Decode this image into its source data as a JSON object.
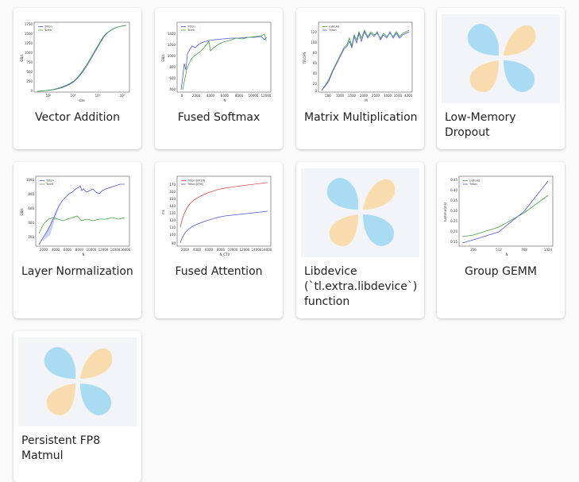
{
  "gallery": {
    "cards": [
      {
        "title": "Vector Addition"
      },
      {
        "title": "Fused Softmax"
      },
      {
        "title": "Matrix Multiplication"
      },
      {
        "title": "Low-Memory Dropout"
      },
      {
        "title": "Layer Normalization"
      },
      {
        "title": "Fused Attention"
      },
      {
        "title": "Libdevice (`tl.extra.libdevice`) function"
      },
      {
        "title": "Group GEMM"
      },
      {
        "title": "Persistent FP8 Matmul"
      }
    ]
  },
  "colors": {
    "blue_series": "#4a55d6",
    "green_series": "#3fa33f",
    "red_series": "#e04545",
    "logo_blue": "#a9dcf3",
    "logo_orange": "#f9dcae"
  },
  "thumbnails": {
    "vector_addition": {
      "legend": [
        "Triton",
        "Torch"
      ],
      "xlabel": "size",
      "ylabel": "GB/s",
      "yticks": [
        "1750",
        "1500",
        "1250",
        "1000",
        "750",
        "500",
        "250",
        "0"
      ],
      "xticks": [
        "10⁴",
        "10⁵",
        "10⁶",
        "10⁷"
      ]
    },
    "fused_softmax": {
      "legend": [
        "Triton",
        "Torch"
      ],
      "xlabel": "N",
      "ylabel": "GB/s",
      "yticks": [
        "1400",
        "1200",
        "1000",
        "800",
        "600",
        "400"
      ],
      "xticks": [
        "0",
        "2000",
        "4000",
        "6000",
        "8000",
        "10000",
        "12000"
      ]
    },
    "matrix_multiplication": {
      "legend": [
        "cuBLAS",
        "Triton"
      ],
      "xlabel": "M",
      "ylabel": "TFLOPS",
      "yticks": [
        "120",
        "100",
        "80",
        "60",
        "40",
        "20",
        "0"
      ],
      "xticks": [
        "500",
        "1000",
        "1500",
        "2000",
        "2500",
        "3000",
        "3500",
        "4000"
      ]
    },
    "layer_normalization": {
      "legend": [
        "Triton",
        "Torch"
      ],
      "xlabel": "N",
      "ylabel": "GB/s",
      "yticks": [
        "1000",
        "800",
        "600",
        "400",
        "200"
      ],
      "xticks": [
        "2000",
        "4000",
        "6000",
        "8000",
        "10000",
        "12000",
        "14000",
        "16000"
      ]
    },
    "fused_attention": {
      "legend": [
        "Triton [FP16]",
        "Triton [FP8]"
      ],
      "xlabel": "N_CTX",
      "ylabel": "ms",
      "yticks": [
        "170",
        "160",
        "150",
        "140",
        "130",
        "120",
        "110",
        "100",
        "90"
      ],
      "xticks": [
        "2000",
        "4000",
        "6000",
        "8000",
        "10000",
        "12000",
        "14000",
        "16000"
      ]
    },
    "group_gemm": {
      "legend": [
        "cuBLAS",
        "Triton"
      ],
      "xlabel": "N",
      "ylabel": "runtime(ms)",
      "yticks": [
        "0.45",
        "0.40",
        "0.35",
        "0.30",
        "0.25",
        "0.20",
        "0.15"
      ],
      "xticks": [
        "256",
        "512",
        "768",
        "1024"
      ]
    }
  }
}
